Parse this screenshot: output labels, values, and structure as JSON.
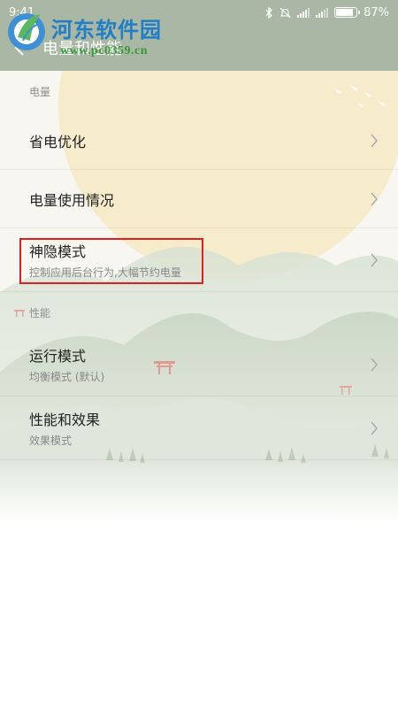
{
  "status_bar": {
    "time": "9:41",
    "battery_percent": 87,
    "battery_label": "87%",
    "icons": [
      "bluetooth-icon",
      "mute-icon",
      "signal-icon",
      "signal-icon",
      "battery-icon"
    ]
  },
  "header": {
    "title": "电量和性能",
    "back_icon": "back-arrow-icon"
  },
  "watermark": {
    "title": "河东软件园",
    "url": "www.pc0359.cn"
  },
  "sections": [
    {
      "header": "电量",
      "items": [
        {
          "title": "省电优化",
          "subtitle": ""
        },
        {
          "title": "电量使用情况",
          "subtitle": ""
        },
        {
          "title": "神隐模式",
          "subtitle": "控制应用后台行为,大幅节约电量"
        }
      ]
    },
    {
      "header": "性能",
      "items": [
        {
          "title": "运行模式",
          "subtitle": "均衡模式 (默认)"
        },
        {
          "title": "性能和效果",
          "subtitle": "效果模式"
        }
      ]
    }
  ],
  "colors": {
    "status_bar_bg": "#a9b7a4",
    "highlight": "#e02020",
    "sun": "#f6eccc",
    "text_primary": "#222222",
    "text_secondary": "#888888"
  }
}
